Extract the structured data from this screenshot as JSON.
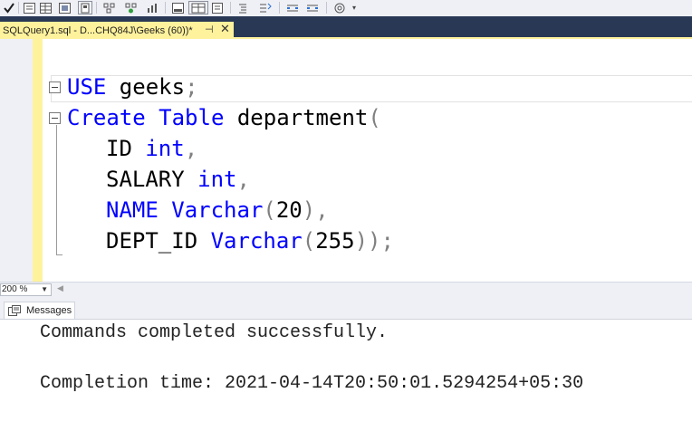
{
  "toolbar": {
    "icons": [
      "checkmark-icon",
      "results-to-text-icon",
      "results-to-grid-icon",
      "results-to-file-icon",
      "include-plan-icon",
      "live-stats-icon",
      "query-options-icon",
      "client-stats-icon",
      "sql-cmd-mode-icon",
      "comment-icon",
      "uncomment-icon",
      "decrease-indent-icon",
      "increase-indent-icon",
      "specify-values-icon",
      "overflow-icon"
    ]
  },
  "document_tab": {
    "title": "SQLQuery1.sql - D...CHQ84J\\Geeks (60))*",
    "pin_glyph": "⊣",
    "close_glyph": "✕",
    "color": "#fff29d"
  },
  "editor": {
    "keyword_color": "#0000ff",
    "lines": {
      "l1": {
        "kw1": "USE",
        "rest": " geeks",
        "punct": ";"
      },
      "l2": {
        "kw1": "Create",
        "kw2": "Table",
        "rest": " department",
        "punct": "("
      },
      "l3": {
        "rest": "ID ",
        "kw1": "int",
        "punct": ","
      },
      "l4": {
        "rest": "SALARY ",
        "kw1": "int",
        "punct": ","
      },
      "l5": {
        "kw1": "NAME",
        "kw2": "Varchar",
        "p1": "(",
        "num": "20",
        "punct": "),"
      },
      "l6": {
        "rest": "DEPT_ID ",
        "kw1": "Varchar",
        "p1": "(",
        "num": "255",
        "punct": "));"
      }
    }
  },
  "zoom": {
    "value": "200 %"
  },
  "results": {
    "tab_label": "Messages",
    "line1": "Commands completed successfully.",
    "line2": "Completion time: 2021-04-14T20:50:01.5294254+05:30"
  }
}
